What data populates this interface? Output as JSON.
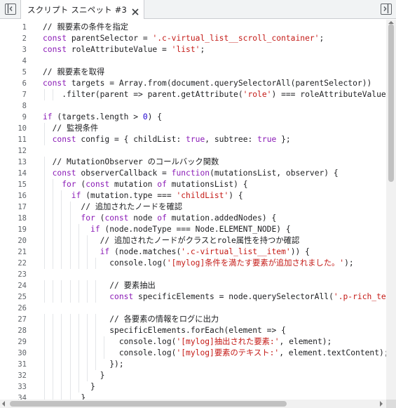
{
  "tab": {
    "title": "スクリプト スニペット #3"
  },
  "toolbar": {
    "left_icon": "toggle-navigator-icon",
    "right_icon": "toggle-sidebar-icon",
    "close_icon": "close-icon"
  },
  "colors": {
    "keyword": "#8a1ab6",
    "string": "#c41a16",
    "number": "#1c00cf",
    "line_numbers": "#5f6368"
  },
  "editor": {
    "lines": [
      {
        "n": "1",
        "indent": 1,
        "tokens": [
          {
            "t": "// 親要素の条件を指定",
            "c": "comment"
          }
        ]
      },
      {
        "n": "2",
        "indent": 1,
        "tokens": [
          {
            "t": "const ",
            "c": "kw"
          },
          {
            "t": "parentSelector = "
          },
          {
            "t": "'.c-virtual_list__scroll_container'",
            "c": "str"
          },
          {
            "t": ";"
          }
        ]
      },
      {
        "n": "3",
        "indent": 1,
        "tokens": [
          {
            "t": "const ",
            "c": "kw"
          },
          {
            "t": "roleAttributeValue = "
          },
          {
            "t": "'list'",
            "c": "str"
          },
          {
            "t": ";"
          }
        ]
      },
      {
        "n": "4",
        "indent": 0,
        "tokens": []
      },
      {
        "n": "5",
        "indent": 1,
        "tokens": [
          {
            "t": "// 親要素を取得",
            "c": "comment"
          }
        ]
      },
      {
        "n": "6",
        "indent": 1,
        "tokens": [
          {
            "t": "const ",
            "c": "kw"
          },
          {
            "t": "targets = Array.from(document.querySelectorAll(parentSelector))"
          }
        ]
      },
      {
        "n": "7",
        "indent": 1,
        "tokens": [
          {
            "t": "    .filter(parent => parent.getAttribute("
          },
          {
            "t": "'role'",
            "c": "str"
          },
          {
            "t": ") === roleAttributeValue);"
          }
        ]
      },
      {
        "n": "8",
        "indent": 0,
        "tokens": []
      },
      {
        "n": "9",
        "indent": 1,
        "tokens": [
          {
            "t": "if ",
            "c": "kw"
          },
          {
            "t": "(targets.length > "
          },
          {
            "t": "0",
            "c": "num"
          },
          {
            "t": ") {"
          }
        ]
      },
      {
        "n": "10",
        "indent": 1,
        "tokens": [
          {
            "t": "  // 監視条件",
            "c": "comment"
          }
        ]
      },
      {
        "n": "11",
        "indent": 1,
        "tokens": [
          {
            "t": "  const ",
            "c": "kw"
          },
          {
            "t": "config = { childList: "
          },
          {
            "t": "true",
            "c": "kw"
          },
          {
            "t": ", subtree: "
          },
          {
            "t": "true",
            "c": "kw"
          },
          {
            "t": " };"
          }
        ]
      },
      {
        "n": "12",
        "indent": 0,
        "tokens": []
      },
      {
        "n": "13",
        "indent": 1,
        "tokens": [
          {
            "t": "  // MutationObserver のコールバック関数",
            "c": "comment"
          }
        ]
      },
      {
        "n": "14",
        "indent": 1,
        "tokens": [
          {
            "t": "  const ",
            "c": "kw"
          },
          {
            "t": "observerCallback = "
          },
          {
            "t": "function",
            "c": "kw"
          },
          {
            "t": "(mutationsList, observer) {"
          }
        ]
      },
      {
        "n": "15",
        "indent": 1,
        "tokens": [
          {
            "t": "    for ",
            "c": "kw"
          },
          {
            "t": "("
          },
          {
            "t": "const ",
            "c": "kw"
          },
          {
            "t": "mutation "
          },
          {
            "t": "of ",
            "c": "kw"
          },
          {
            "t": "mutationsList) {"
          }
        ]
      },
      {
        "n": "16",
        "indent": 1,
        "tokens": [
          {
            "t": "      if ",
            "c": "kw"
          },
          {
            "t": "(mutation.type === "
          },
          {
            "t": "'childList'",
            "c": "str"
          },
          {
            "t": ") {"
          }
        ]
      },
      {
        "n": "17",
        "indent": 1,
        "tokens": [
          {
            "t": "        // 追加されたノードを確認",
            "c": "comment"
          }
        ]
      },
      {
        "n": "18",
        "indent": 1,
        "tokens": [
          {
            "t": "        for ",
            "c": "kw"
          },
          {
            "t": "("
          },
          {
            "t": "const ",
            "c": "kw"
          },
          {
            "t": "node "
          },
          {
            "t": "of ",
            "c": "kw"
          },
          {
            "t": "mutation.addedNodes) {"
          }
        ]
      },
      {
        "n": "19",
        "indent": 1,
        "tokens": [
          {
            "t": "          if ",
            "c": "kw"
          },
          {
            "t": "(node.nodeType === Node.ELEMENT_NODE) {"
          }
        ]
      },
      {
        "n": "20",
        "indent": 1,
        "tokens": [
          {
            "t": "            // 追加されたノードがクラスとrole属性を持つか確認",
            "c": "comment"
          }
        ]
      },
      {
        "n": "21",
        "indent": 1,
        "tokens": [
          {
            "t": "            if ",
            "c": "kw"
          },
          {
            "t": "(node.matches("
          },
          {
            "t": "'.c-virtual_list__item'",
            "c": "str"
          },
          {
            "t": ")) {"
          }
        ]
      },
      {
        "n": "22",
        "indent": 1,
        "tokens": [
          {
            "t": "              console.log("
          },
          {
            "t": "'[mylog]条件を満たす要素が追加されました。'",
            "c": "str"
          },
          {
            "t": ");"
          }
        ]
      },
      {
        "n": "23",
        "indent": 0,
        "tokens": []
      },
      {
        "n": "24",
        "indent": 1,
        "tokens": [
          {
            "t": "              // 要素抽出",
            "c": "comment"
          }
        ]
      },
      {
        "n": "25",
        "indent": 1,
        "tokens": [
          {
            "t": "              const ",
            "c": "kw"
          },
          {
            "t": "specificElements = node.querySelectorAll("
          },
          {
            "t": "'.p-rich_text_section'",
            "c": "str"
          },
          {
            "t": ");"
          }
        ]
      },
      {
        "n": "26",
        "indent": 0,
        "tokens": []
      },
      {
        "n": "27",
        "indent": 1,
        "tokens": [
          {
            "t": "              // 各要素の情報をログに出力",
            "c": "comment"
          }
        ]
      },
      {
        "n": "28",
        "indent": 1,
        "tokens": [
          {
            "t": "              specificElements.forEach(element => {"
          }
        ]
      },
      {
        "n": "29",
        "indent": 1,
        "tokens": [
          {
            "t": "                console.log("
          },
          {
            "t": "'[mylog]抽出された要素:'",
            "c": "str"
          },
          {
            "t": ", element);"
          }
        ]
      },
      {
        "n": "30",
        "indent": 1,
        "tokens": [
          {
            "t": "                console.log("
          },
          {
            "t": "'[mylog]要素のテキスト:'",
            "c": "str"
          },
          {
            "t": ", element.textContent);"
          }
        ]
      },
      {
        "n": "31",
        "indent": 1,
        "tokens": [
          {
            "t": "              });"
          }
        ]
      },
      {
        "n": "32",
        "indent": 1,
        "tokens": [
          {
            "t": "            }"
          }
        ]
      },
      {
        "n": "33",
        "indent": 1,
        "tokens": [
          {
            "t": "          }"
          }
        ]
      },
      {
        "n": "34",
        "indent": 1,
        "tokens": [
          {
            "t": "        }"
          }
        ]
      }
    ]
  }
}
